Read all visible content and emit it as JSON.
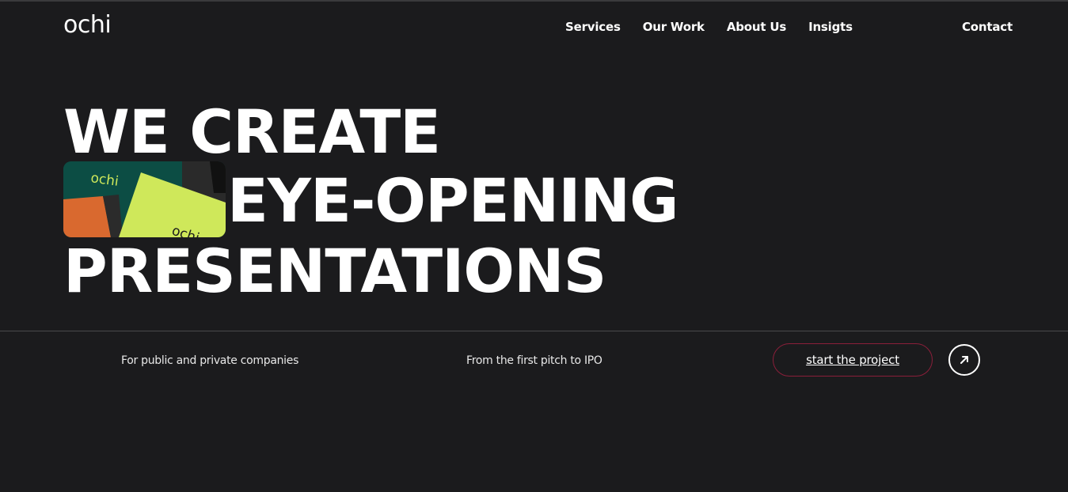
{
  "brand": {
    "logo_text": "ochi"
  },
  "nav": {
    "items": [
      {
        "label": "Services"
      },
      {
        "label": "Our Work"
      },
      {
        "label": "About Us"
      },
      {
        "label": "Insigts"
      }
    ],
    "contact_label": "Contact"
  },
  "hero": {
    "line1": "WE CREATE",
    "line2": "EYE-OPENING",
    "line3": "PRESENTATIONS",
    "image": {
      "brand_text_1": "ochi",
      "brand_text_2": "ochi"
    }
  },
  "footer_row": {
    "tagline_1": "For public and private companies",
    "tagline_2": "From the first pitch to IPO",
    "cta_label": "start the project",
    "arrow_icon": "arrow-up-right-icon"
  },
  "colors": {
    "background": "#1b1b1d",
    "text": "#ffffff",
    "cta_border": "#8b1f3a",
    "card_green": "#0c4d44",
    "card_lime": "#cfe85a",
    "card_orange": "#d9692f"
  }
}
